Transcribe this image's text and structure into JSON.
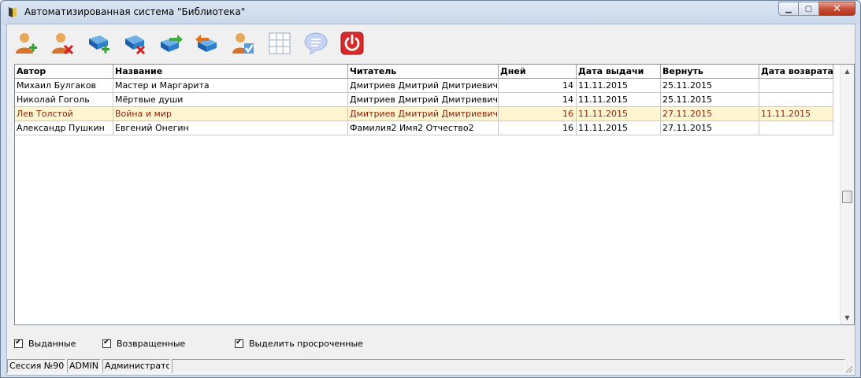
{
  "window": {
    "title": "Автоматизированная система \"Библиотека\""
  },
  "toolbar": [
    {
      "name": "add-reader-button",
      "icon": "user-add-icon"
    },
    {
      "name": "delete-reader-button",
      "icon": "user-delete-icon"
    },
    {
      "name": "add-book-button",
      "icon": "book-add-icon"
    },
    {
      "name": "delete-book-button",
      "icon": "book-delete-icon"
    },
    {
      "name": "issue-book-button",
      "icon": "book-issue-icon"
    },
    {
      "name": "return-book-button",
      "icon": "book-return-icon"
    },
    {
      "name": "check-reader-button",
      "icon": "user-check-icon"
    },
    {
      "name": "grid-button",
      "icon": "grid-icon"
    },
    {
      "name": "message-button",
      "icon": "speech-bubble-icon"
    },
    {
      "name": "exit-button",
      "icon": "power-icon"
    }
  ],
  "table": {
    "columns": [
      "Автор",
      "Название",
      "Читатель",
      "Дней",
      "Дата выдачи",
      "Вернуть",
      "Дата возврата"
    ],
    "rows": [
      [
        "Михаил Булгаков",
        "Мастер и Маргарита",
        "Дмитриев Дмитрий Дмитриевич",
        "14",
        "11.11.2015",
        "25.11.2015",
        ""
      ],
      [
        "Николай Гоголь",
        "Мёртвые души",
        "Дмитриев Дмитрий Дмитриевич",
        "14",
        "11.11.2015",
        "25.11.2015",
        ""
      ],
      [
        "Лев Толстой",
        "Война и мир",
        "Дмитриев Дмитрий Дмитриевич",
        "16",
        "11.11.2015",
        "27.11.2015",
        "11.11.2015"
      ],
      [
        "Александр Пушкин",
        "Евгений Онегин",
        "Фамилия2 Имя2 Отчество2",
        "16",
        "11.11.2015",
        "27.11.2015",
        ""
      ]
    ],
    "highlighted_row": 2
  },
  "filters": {
    "issued": {
      "label": "Выданные",
      "checked": true
    },
    "returned": {
      "label": "Возвращенные",
      "checked": true
    },
    "overdue": {
      "label": "Выделить просроченные",
      "checked": true
    }
  },
  "status": {
    "session": "Сессия №90",
    "user": "ADMIN",
    "role": "Администратор",
    "extra": ""
  },
  "colors": {
    "overdue_row_bg": "#fff5d0",
    "overdue_row_text": "#8a1f0a",
    "close_button": "#c7503a"
  }
}
